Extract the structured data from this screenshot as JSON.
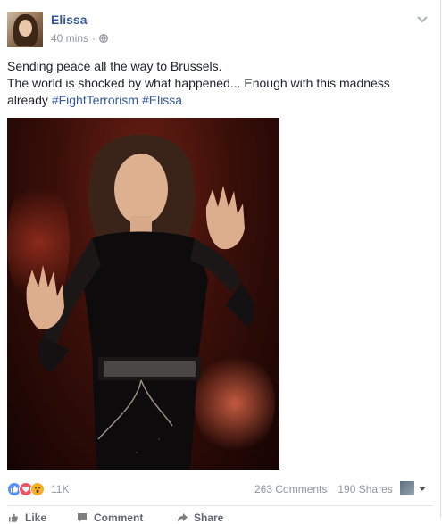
{
  "post": {
    "author": "Elissa",
    "timestamp": "40 mins",
    "separator": "·",
    "privacy_icon": "globe-icon",
    "lines": [
      "Sending peace all the way to Brussels.",
      "The world is shocked by what happened... Enough with this madness"
    ],
    "line3_prefix": "already ",
    "hashtags": [
      "#FightTerrorism",
      "#Elissa"
    ]
  },
  "engagement": {
    "reaction_icons": [
      "like-icon",
      "love-icon",
      "wow-icon"
    ],
    "reactions_count": "11K",
    "comments": "263 Comments",
    "shares": "190 Shares"
  },
  "actions": {
    "like": "Like",
    "comment": "Comment",
    "share": "Share"
  },
  "colors": {
    "link": "#365899",
    "meta": "#90949c",
    "like": "#5890ff",
    "love": "#f25268",
    "wow": "#f7b125"
  }
}
